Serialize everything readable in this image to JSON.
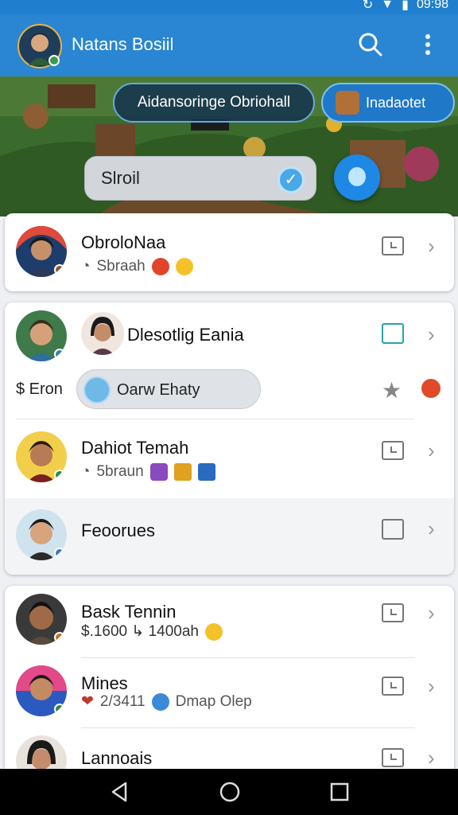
{
  "status": {
    "time": "09:98"
  },
  "appbar": {
    "title": "Natans Bosiil"
  },
  "banner": {
    "chip_primary": "Aidansoringe Obriohall",
    "chip_secondary": "Inadaotet",
    "search_value": "Slroil"
  },
  "cards": [
    {
      "rows": [
        {
          "name": "ObrolоNaa",
          "sub": "Sbraah"
        }
      ]
    },
    {
      "rows": [
        {
          "name": "Dlesotlig Eania"
        },
        {
          "left_label": "$ Eron",
          "pill": "Oarw Ehaty"
        },
        {
          "name": "Dahiot Temah",
          "sub": "5brаun"
        },
        {
          "name": "Feoorues"
        }
      ]
    },
    {
      "rows": [
        {
          "name": "Bask Tennin",
          "sub": "$.1600 ↳ 1400ah"
        },
        {
          "name": "Mines",
          "sub": "2/3411",
          "sub2": "Dmap Olep"
        },
        {
          "name": "Lannoais"
        }
      ]
    }
  ],
  "colors": {
    "appbar": "#2a86d2",
    "accent": "#1e88e5",
    "card": "#ffffff"
  }
}
